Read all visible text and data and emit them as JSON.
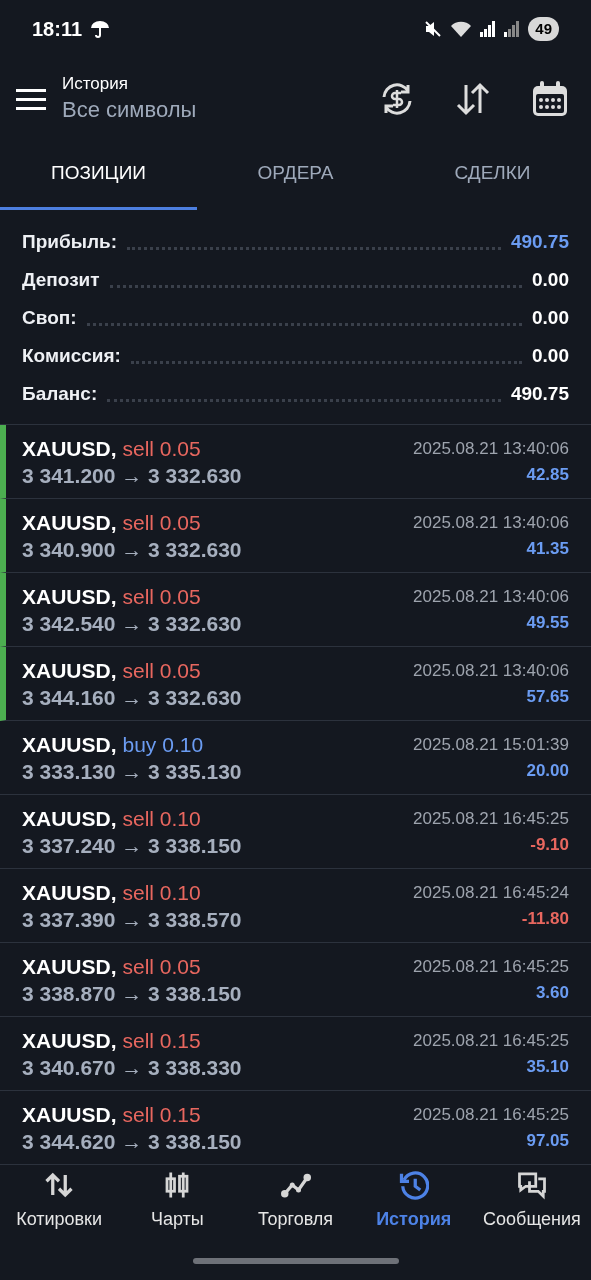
{
  "status_bar": {
    "time": "18:11",
    "battery": "49"
  },
  "header": {
    "title": "История",
    "subtitle": "Все символы"
  },
  "tabs": [
    {
      "label": "ПОЗИЦИИ",
      "selected": true
    },
    {
      "label": "ОРДЕРА",
      "selected": false
    },
    {
      "label": "СДЕЛКИ",
      "selected": false
    }
  ],
  "summary": [
    {
      "label": "Прибыль:",
      "value": "490.75",
      "highlight": true
    },
    {
      "label": "Депозит",
      "value": "0.00",
      "highlight": false
    },
    {
      "label": "Своп:",
      "value": "0.00",
      "highlight": false
    },
    {
      "label": "Комиссия:",
      "value": "0.00",
      "highlight": false
    },
    {
      "label": "Баланс:",
      "value": "490.75",
      "highlight": false
    }
  ],
  "positions": [
    {
      "symbol": "XAUUSD,",
      "kind": "sell",
      "order": "sell 0.05",
      "prices": "3 341.200 → 3 332.630",
      "time": "2025.08.21 13:40:06",
      "profit": "42.85",
      "loss": false,
      "flagged": true
    },
    {
      "symbol": "XAUUSD,",
      "kind": "sell",
      "order": "sell 0.05",
      "prices": "3 340.900 → 3 332.630",
      "time": "2025.08.21 13:40:06",
      "profit": "41.35",
      "loss": false,
      "flagged": true
    },
    {
      "symbol": "XAUUSD,",
      "kind": "sell",
      "order": "sell 0.05",
      "prices": "3 342.540 → 3 332.630",
      "time": "2025.08.21 13:40:06",
      "profit": "49.55",
      "loss": false,
      "flagged": true
    },
    {
      "symbol": "XAUUSD,",
      "kind": "sell",
      "order": "sell 0.05",
      "prices": "3 344.160 → 3 332.630",
      "time": "2025.08.21 13:40:06",
      "profit": "57.65",
      "loss": false,
      "flagged": true
    },
    {
      "symbol": "XAUUSD,",
      "kind": "buy",
      "order": "buy 0.10",
      "prices": "3 333.130 → 3 335.130",
      "time": "2025.08.21 15:01:39",
      "profit": "20.00",
      "loss": false,
      "flagged": false
    },
    {
      "symbol": "XAUUSD,",
      "kind": "sell",
      "order": "sell 0.10",
      "prices": "3 337.240 → 3 338.150",
      "time": "2025.08.21 16:45:25",
      "profit": "-9.10",
      "loss": true,
      "flagged": false
    },
    {
      "symbol": "XAUUSD,",
      "kind": "sell",
      "order": "sell 0.10",
      "prices": "3 337.390 → 3 338.570",
      "time": "2025.08.21 16:45:24",
      "profit": "-11.80",
      "loss": true,
      "flagged": false
    },
    {
      "symbol": "XAUUSD,",
      "kind": "sell",
      "order": "sell 0.05",
      "prices": "3 338.870 → 3 338.150",
      "time": "2025.08.21 16:45:25",
      "profit": "3.60",
      "loss": false,
      "flagged": false
    },
    {
      "symbol": "XAUUSD,",
      "kind": "sell",
      "order": "sell 0.15",
      "prices": "3 340.670 → 3 338.330",
      "time": "2025.08.21 16:45:25",
      "profit": "35.10",
      "loss": false,
      "flagged": false
    },
    {
      "symbol": "XAUUSD,",
      "kind": "sell",
      "order": "sell 0.15",
      "prices": "3 344.620 → 3 338.150",
      "time": "2025.08.21 16:45:25",
      "profit": "97.05",
      "loss": false,
      "flagged": false
    }
  ],
  "bottom_nav": [
    {
      "label": "Котировки",
      "selected": false
    },
    {
      "label": "Чарты",
      "selected": false
    },
    {
      "label": "Торговля",
      "selected": false
    },
    {
      "label": "История",
      "selected": true
    },
    {
      "label": "Сообщения",
      "selected": false
    }
  ]
}
